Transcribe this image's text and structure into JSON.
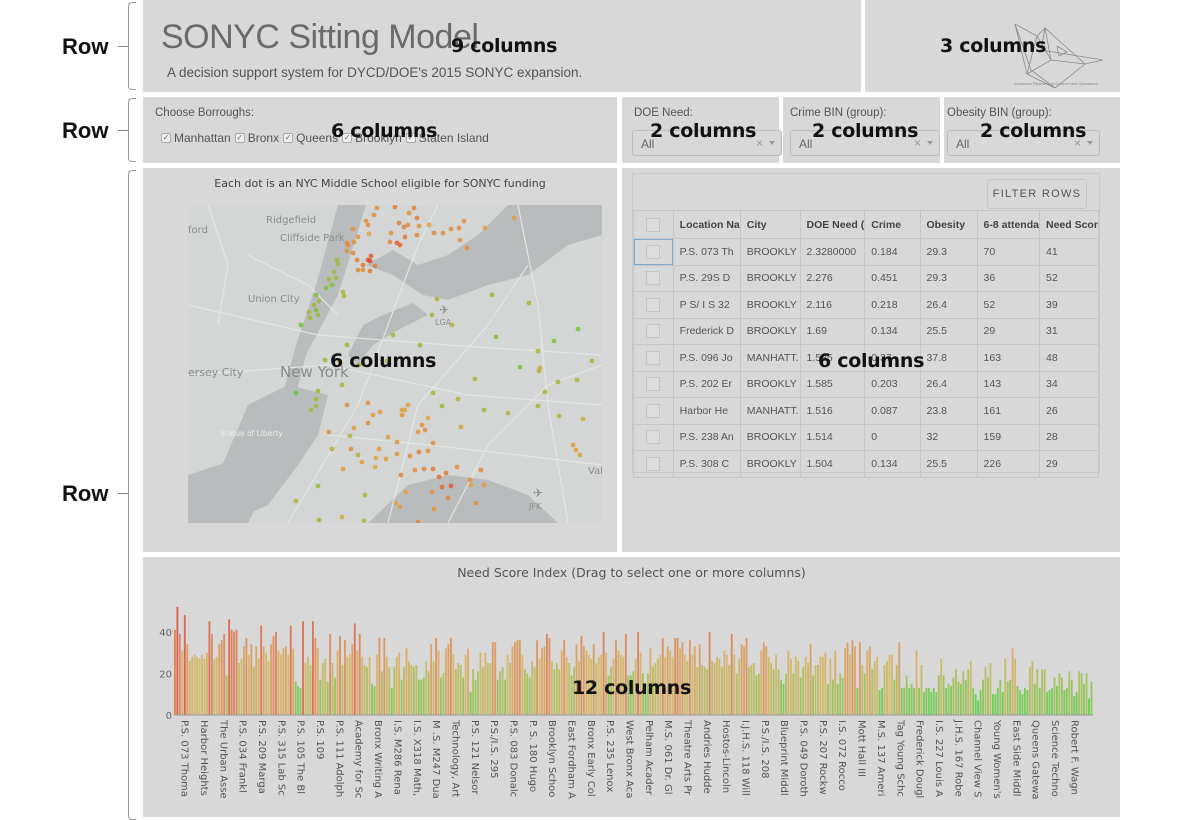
{
  "annotations": {
    "row_labels": [
      "Row",
      "Row",
      "Row"
    ],
    "column_labels": {
      "header_title": "9 columns",
      "header_logo": "3 columns",
      "boroughs": "6 columns",
      "doe_need": "2 columns",
      "crime_bin": "2 columns",
      "obesity_bin": "2 columns",
      "map": "6 columns",
      "table": "6 columns",
      "chart": "12 columns"
    }
  },
  "header": {
    "title": "SONYC Sitting Model",
    "subtitle": "A decision support system for DYCD/DOE's 2015 SONYC expansion.",
    "logo_caption": "Advanced Research in Government Operations",
    "logo_icon": "paper-boat-icon"
  },
  "filters": {
    "boroughs": {
      "label": "Choose Borroughs:",
      "options": [
        {
          "label": "Manhattan",
          "checked": true
        },
        {
          "label": "Bronx",
          "checked": true
        },
        {
          "label": "Queens",
          "checked": true
        },
        {
          "label": "Brooklyn",
          "checked": true
        },
        {
          "label": "Staten Island",
          "checked": true
        }
      ]
    },
    "doe_need": {
      "label": "DOE Need:",
      "value": "All"
    },
    "crime_bin": {
      "label": "Crime BIN (group):",
      "value": "All"
    },
    "obesity_bin": {
      "label": "Obesity BIN (group):",
      "value": "All"
    }
  },
  "map": {
    "caption": "Each dot is an NYC Middle School eligible for SONYC funding",
    "place_labels": [
      "Ridgefield",
      "Cliffside Park",
      "Union City",
      "LGA",
      "New York",
      "ersey City",
      "Statue of Liberty",
      "JFK",
      "Val",
      "ford"
    ],
    "colors": {
      "high": "#e0463a",
      "mid": "#e0a84a",
      "low": "#4fd03c"
    }
  },
  "table": {
    "filter_button": "FILTER ROWS",
    "columns": [
      "Location Na",
      "City",
      "DOE Need (",
      "Crime",
      "Obesity",
      "6-8 attenda",
      "Need Scor"
    ],
    "rows": [
      [
        "P.S. 073 Th",
        "BROOKLY",
        "2.3280000",
        "0.184",
        "29.3",
        "70",
        "41"
      ],
      [
        "P.S. 29S D",
        "BROOKLY",
        "2.276",
        "0.451",
        "29.3",
        "36",
        "52"
      ],
      [
        "P S/ I S 32",
        "BROOKLY",
        "2.116",
        "0.218",
        "26.4",
        "52",
        "39"
      ],
      [
        "Frederick D",
        "BROOKLY",
        "1.69",
        "0.134",
        "25.5",
        "29",
        "31"
      ],
      [
        "P.S. 096 Jo",
        "MANHATT.",
        "1.585",
        "0.37",
        "37.8",
        "163",
        "48"
      ],
      [
        "P.S. 202 Er",
        "BROOKLY",
        "1.585",
        "0.203",
        "26.4",
        "143",
        "34"
      ],
      [
        "Harbor He",
        "MANHATT.",
        "1.516",
        "0.087",
        "23.8",
        "161",
        "26"
      ],
      [
        "P.S. 238 An",
        "BROOKLY",
        "1.514",
        "0",
        "32",
        "159",
        "28"
      ],
      [
        "P.S. 308 C",
        "BROOKLY",
        "1.504",
        "0.134",
        "25.5",
        "226",
        "29"
      ]
    ]
  },
  "chart_data": {
    "type": "bar",
    "title": "Need Score Index (Drag to select one or more columns)",
    "xlabel": "",
    "ylabel": "",
    "ylim": [
      0,
      52
    ],
    "yticks": [
      0,
      20,
      40
    ],
    "grid": false,
    "color_scale": {
      "low": "#4fd03c",
      "mid": "#d9b25a",
      "high": "#e0463a"
    },
    "x_tick_labels": [
      "P.S. 073 Thoma",
      "Harbor Heights",
      "The Urban Asse",
      "P.S. 034 Frankl",
      "P.S. 209 Marga",
      "P.S. 315 Lab Sc",
      "P.S. 105 The Bl",
      "P.S. 109",
      "P.S. 111 Adolph",
      "Academy for Sc",
      "Bronx Writing A",
      "I.S. M286 Rena",
      "I.S. X318 Math,",
      "M .S. M247 Dua",
      "Technology, Art",
      "P.S. 121 Nelsor",
      "P.S./I.S. 295",
      "P.S. 083 Donalc",
      "P. S. 180 Hugo",
      "Brooklyn Schoo",
      "East Fordham A",
      "Bronx Early Col",
      "P.S. 235 Lenox",
      "West Bronx Aca",
      "Pelham Acader",
      "M.S. 061 Dr. Gl",
      "Theatre Arts Pr",
      "Andries Hudde",
      "Hostos-Lincoln",
      "I.J.H.S. 118 Will",
      "P.S./I.S. 208",
      "Blueprint Middl",
      "P.S. 049 Doroth",
      "P.S. 207 Rockw",
      "I.S. 072 Rocco",
      "Mott Hall III",
      "M.S. 137 Ameri",
      "Tag Young Schc",
      "Frederick Dougl",
      "I.S. 227 Louis A",
      "J.H.S. 167 Robe",
      "Channel View S",
      "Young Women's",
      "East Side Middl",
      "Queens Gatewa",
      "Science Techno",
      "Robert F. Wagn"
    ],
    "values": [
      41,
      52,
      39,
      31,
      48,
      34,
      26,
      28,
      29,
      28,
      27,
      29,
      27,
      30,
      45,
      39,
      27,
      28,
      34,
      36,
      39,
      19,
      46,
      41,
      40,
      41,
      25,
      27,
      33,
      37,
      29,
      34,
      23,
      33,
      27,
      43,
      33,
      30,
      26,
      34,
      38,
      40,
      31,
      29,
      32,
      33,
      29,
      43,
      32,
      16,
      14,
      13,
      45,
      25,
      28,
      24,
      45,
      37,
      32,
      17,
      25,
      27,
      16,
      39,
      25,
      18,
      31,
      38,
      24,
      36,
      28,
      29,
      34,
      44,
      31,
      39,
      28,
      24,
      23,
      28,
      15,
      14,
      29,
      37,
      21,
      37,
      28,
      23,
      13,
      23,
      28,
      30,
      17,
      23,
      32,
      26,
      24,
      23,
      24,
      17,
      17,
      18,
      26,
      21,
      34,
      26,
      37,
      31,
      18,
      20,
      32,
      34,
      37,
      29,
      22,
      25,
      24,
      18,
      29,
      32,
      11,
      22,
      17,
      21,
      30,
      23,
      30,
      25,
      25,
      35,
      35,
      17,
      21,
      23,
      17,
      29,
      25,
      33,
      35,
      36,
      36,
      29,
      22,
      20,
      18,
      26,
      23,
      36,
      27,
      32,
      33,
      39,
      37,
      26,
      22,
      25,
      22,
      31,
      36,
      28,
      25,
      19,
      23,
      34,
      26,
      38,
      33,
      31,
      29,
      27,
      34,
      25,
      28,
      29,
      40,
      30,
      19,
      23,
      27,
      36,
      31,
      29,
      28,
      39,
      19,
      19,
      21,
      27,
      40,
      30,
      20,
      14,
      20,
      32,
      23,
      25,
      27,
      29,
      37,
      28,
      33,
      31,
      28,
      37,
      37,
      32,
      35,
      29,
      26,
      36,
      29,
      33,
      23,
      34,
      24,
      23,
      22,
      40,
      26,
      25,
      28,
      27,
      23,
      31,
      29,
      24,
      39,
      29,
      20,
      27,
      34,
      33,
      37,
      23,
      24,
      25,
      19,
      20,
      31,
      35,
      33,
      28,
      25,
      22,
      29,
      22,
      17,
      15,
      20,
      31,
      27,
      20,
      28,
      26,
      18,
      23,
      28,
      25,
      34,
      19,
      24,
      24,
      28,
      28,
      30,
      15,
      27,
      17,
      31,
      15,
      20,
      18,
      32,
      35,
      29,
      36,
      33,
      13,
      35,
      24,
      20,
      31,
      33,
      22,
      26,
      28,
      12,
      13,
      24,
      26,
      29,
      29,
      17,
      24,
      35,
      13,
      13,
      19,
      13,
      15,
      13,
      31,
      13,
      24,
      11,
      13,
      13,
      11,
      13,
      11,
      19,
      27,
      19,
      13,
      15,
      14,
      18,
      22,
      16,
      15,
      21,
      17,
      22,
      26,
      13,
      10,
      7,
      12,
      17,
      23,
      18,
      25,
      10,
      10,
      13,
      17,
      11,
      27,
      16,
      17,
      32,
      27,
      14,
      12,
      10,
      13,
      12,
      23,
      26,
      15,
      22,
      13,
      22,
      22,
      11,
      12,
      13,
      18,
      14,
      20,
      18,
      12,
      13,
      21,
      17,
      9,
      11,
      21,
      20,
      15,
      20,
      8,
      16
    ]
  }
}
